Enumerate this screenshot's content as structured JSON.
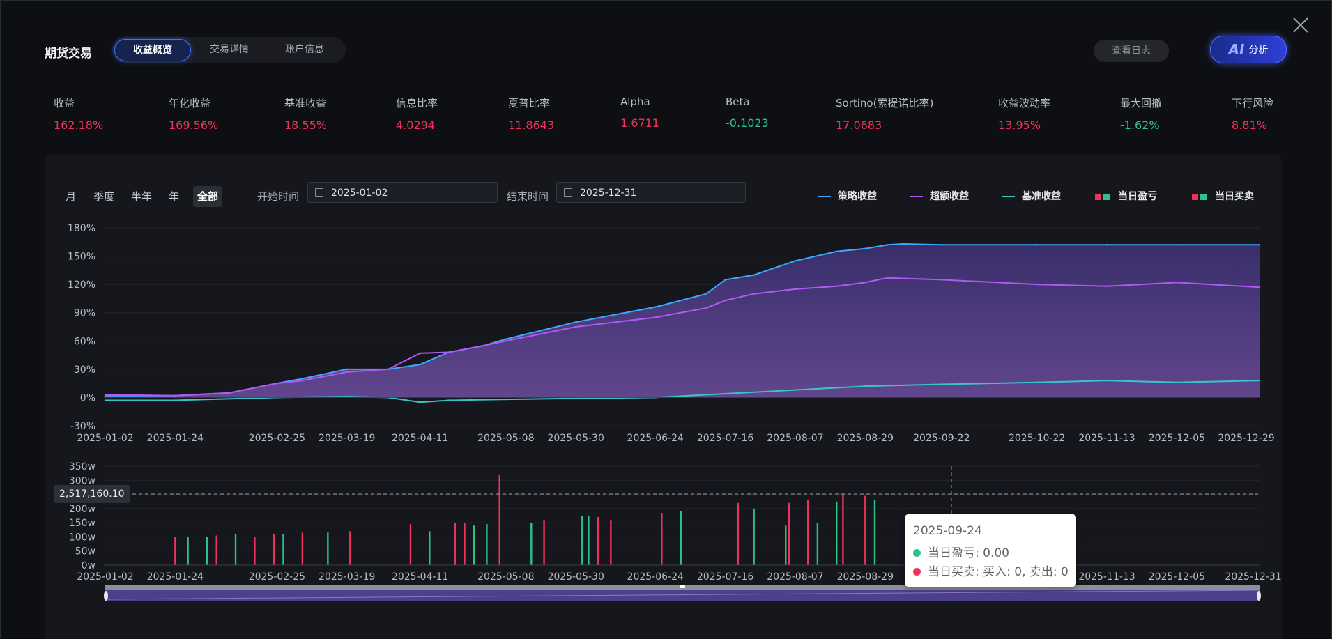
{
  "header": {
    "title": "期货交易",
    "tabs": [
      {
        "label": "收益概览",
        "active": true
      },
      {
        "label": "交易详情",
        "active": false
      },
      {
        "label": "账户信息",
        "active": false
      }
    ],
    "log_button": "查看日志",
    "ai_button": {
      "prefix": "AI",
      "label": "分析"
    }
  },
  "metrics": [
    {
      "label": "收益",
      "value": "162.18%",
      "color": "#f0325a"
    },
    {
      "label": "年化收益",
      "value": "169.56%",
      "color": "#f0325a"
    },
    {
      "label": "基准收益",
      "value": "18.55%",
      "color": "#f0325a"
    },
    {
      "label": "信息比率",
      "value": "4.0294",
      "color": "#f0325a"
    },
    {
      "label": "夏普比率",
      "value": "11.8643",
      "color": "#f0325a"
    },
    {
      "label": "Alpha",
      "value": "1.6711",
      "color": "#f0325a"
    },
    {
      "label": "Beta",
      "value": "-0.1023",
      "color": "#2bc38a"
    },
    {
      "label": "Sortino(索提诺比率)",
      "value": "17.0683",
      "color": "#f0325a"
    },
    {
      "label": "收益波动率",
      "value": "13.95%",
      "color": "#f0325a"
    },
    {
      "label": "最大回撤",
      "value": "-1.62%",
      "color": "#2bc38a"
    },
    {
      "label": "下行风险",
      "value": "8.81%",
      "color": "#f0325a"
    }
  ],
  "filters": {
    "periods": [
      {
        "label": "月",
        "active": false
      },
      {
        "label": "季度",
        "active": false
      },
      {
        "label": "半年",
        "active": false
      },
      {
        "label": "年",
        "active": false
      },
      {
        "label": "全部",
        "active": true
      }
    ],
    "start_label": "开始时间",
    "start_value": "2025-01-02",
    "end_label": "结束时间",
    "end_value": "2025-12-31"
  },
  "legend": [
    {
      "label": "策略收益",
      "type": "line",
      "color": "#3ea6ff"
    },
    {
      "label": "超额收益",
      "type": "line",
      "color": "#b259f5"
    },
    {
      "label": "基准收益",
      "type": "line",
      "color": "#3bc5c5"
    },
    {
      "label": "当日盈亏",
      "type": "bars",
      "colors": [
        "#f0325a",
        "#2bc38a"
      ]
    },
    {
      "label": "当日买卖",
      "type": "bars",
      "colors": [
        "#f0325a",
        "#2bc38a"
      ]
    }
  ],
  "chart_data": [
    {
      "type": "line",
      "x_ticks": [
        "2025-01-02",
        "2025-01-24",
        "2025-02-25",
        "2025-03-19",
        "2025-04-11",
        "2025-05-08",
        "2025-05-30",
        "2025-06-24",
        "2025-07-16",
        "2025-08-07",
        "2025-08-29",
        "2025-09-22",
        "2025-10-22",
        "2025-11-13",
        "2025-12-05",
        "2025-12-29"
      ],
      "y_ticks": [
        "180%",
        "150%",
        "120%",
        "90%",
        "60%",
        "30%",
        "0%",
        "-30%"
      ],
      "ylim": [
        -30,
        180
      ],
      "y_unit": "%",
      "grid": true,
      "series": [
        {
          "name": "策略收益",
          "color": "#3ea6ff",
          "x": [
            "2025-01-02",
            "2025-01-24",
            "2025-02-10",
            "2025-02-25",
            "2025-03-05",
            "2025-03-19",
            "2025-04-01",
            "2025-04-11",
            "2025-04-20",
            "2025-05-01",
            "2025-05-08",
            "2025-05-30",
            "2025-06-24",
            "2025-07-10",
            "2025-07-16",
            "2025-07-25",
            "2025-08-07",
            "2025-08-20",
            "2025-08-29",
            "2025-09-05",
            "2025-09-10",
            "2025-09-22",
            "2025-10-22",
            "2025-11-13",
            "2025-12-05",
            "2025-12-31"
          ],
          "values": [
            2,
            2,
            5,
            15,
            20,
            30,
            30,
            35,
            48,
            55,
            62,
            80,
            96,
            110,
            125,
            130,
            145,
            155,
            158,
            162,
            163,
            162,
            162,
            162,
            162,
            162
          ]
        },
        {
          "name": "超额收益",
          "color": "#b259f5",
          "x": [
            "2025-01-02",
            "2025-01-24",
            "2025-02-10",
            "2025-02-25",
            "2025-03-05",
            "2025-03-19",
            "2025-04-01",
            "2025-04-11",
            "2025-04-20",
            "2025-05-01",
            "2025-05-08",
            "2025-05-30",
            "2025-06-24",
            "2025-07-10",
            "2025-07-16",
            "2025-07-25",
            "2025-08-07",
            "2025-08-20",
            "2025-08-29",
            "2025-09-05",
            "2025-09-22",
            "2025-10-22",
            "2025-11-13",
            "2025-12-05",
            "2025-12-31"
          ],
          "values": [
            3,
            2,
            5,
            15,
            18,
            27,
            30,
            47,
            48,
            55,
            60,
            75,
            85,
            95,
            103,
            110,
            115,
            118,
            122,
            127,
            125,
            120,
            118,
            122,
            117
          ]
        },
        {
          "name": "基准收益",
          "color": "#3bc5c5",
          "x": [
            "2025-01-02",
            "2025-01-24",
            "2025-02-25",
            "2025-03-19",
            "2025-04-01",
            "2025-04-11",
            "2025-04-20",
            "2025-05-08",
            "2025-05-30",
            "2025-06-24",
            "2025-07-16",
            "2025-08-07",
            "2025-08-29",
            "2025-09-22",
            "2025-10-22",
            "2025-11-13",
            "2025-12-05",
            "2025-12-31"
          ],
          "values": [
            -3,
            -3,
            0,
            1,
            0,
            -5,
            -3,
            -2,
            -1,
            0,
            4,
            8,
            12,
            14,
            16,
            18,
            16,
            18
          ]
        }
      ]
    },
    {
      "type": "bar",
      "x_ticks": [
        "2025-01-02",
        "2025-01-24",
        "2025-02-25",
        "2025-03-19",
        "2025-04-11",
        "2025-05-08",
        "2025-05-30",
        "2025-06-24",
        "2025-07-16",
        "2025-08-07",
        "2025-08-29",
        "2025-09-22",
        "2025-10-22",
        "2025-11-13",
        "2025-12-05",
        "2025-12-31"
      ],
      "y_ticks": [
        "350w",
        "300w",
        "250w",
        "200w",
        "150w",
        "100w",
        "50w",
        "0w"
      ],
      "ylim": [
        0,
        350
      ],
      "y_unit": "w",
      "grid": true,
      "crosshair_value": "2,517,160.10",
      "series": [
        {
          "name": "当日买卖",
          "color": "#f0325a",
          "x": [
            "2025-01-24",
            "2025-02-06",
            "2025-02-18",
            "2025-02-24",
            "2025-03-05",
            "2025-03-20",
            "2025-04-08",
            "2025-04-22",
            "2025-04-25",
            "2025-05-06",
            "2025-05-20",
            "2025-06-06",
            "2025-06-10",
            "2025-06-26",
            "2025-07-20",
            "2025-08-05",
            "2025-08-11",
            "2025-08-22",
            "2025-08-29"
          ],
          "values": [
            100,
            105,
            100,
            110,
            115,
            120,
            145,
            148,
            150,
            320,
            160,
            170,
            160,
            185,
            220,
            220,
            230,
            250,
            245
          ]
        },
        {
          "name": "当日盈亏",
          "color": "#2bc38a",
          "x": [
            "2025-01-28",
            "2025-02-03",
            "2025-02-12",
            "2025-02-27",
            "2025-03-13",
            "2025-04-14",
            "2025-04-28",
            "2025-05-02",
            "2025-05-16",
            "2025-06-01",
            "2025-06-03",
            "2025-07-02",
            "2025-07-25",
            "2025-08-04",
            "2025-08-14",
            "2025-08-20",
            "2025-09-01",
            "2025-09-12"
          ],
          "values": [
            100,
            100,
            110,
            110,
            115,
            120,
            140,
            145,
            150,
            175,
            175,
            190,
            200,
            140,
            150,
            225,
            230,
            110
          ]
        }
      ]
    }
  ],
  "tooltip": {
    "date": "2025-09-24",
    "rows": [
      {
        "color": "#2bc38a",
        "text": "当日盈亏: 0.00"
      },
      {
        "color": "#f0325a",
        "text": "当日买卖: 买入: 0, 卖出: 0"
      }
    ]
  }
}
